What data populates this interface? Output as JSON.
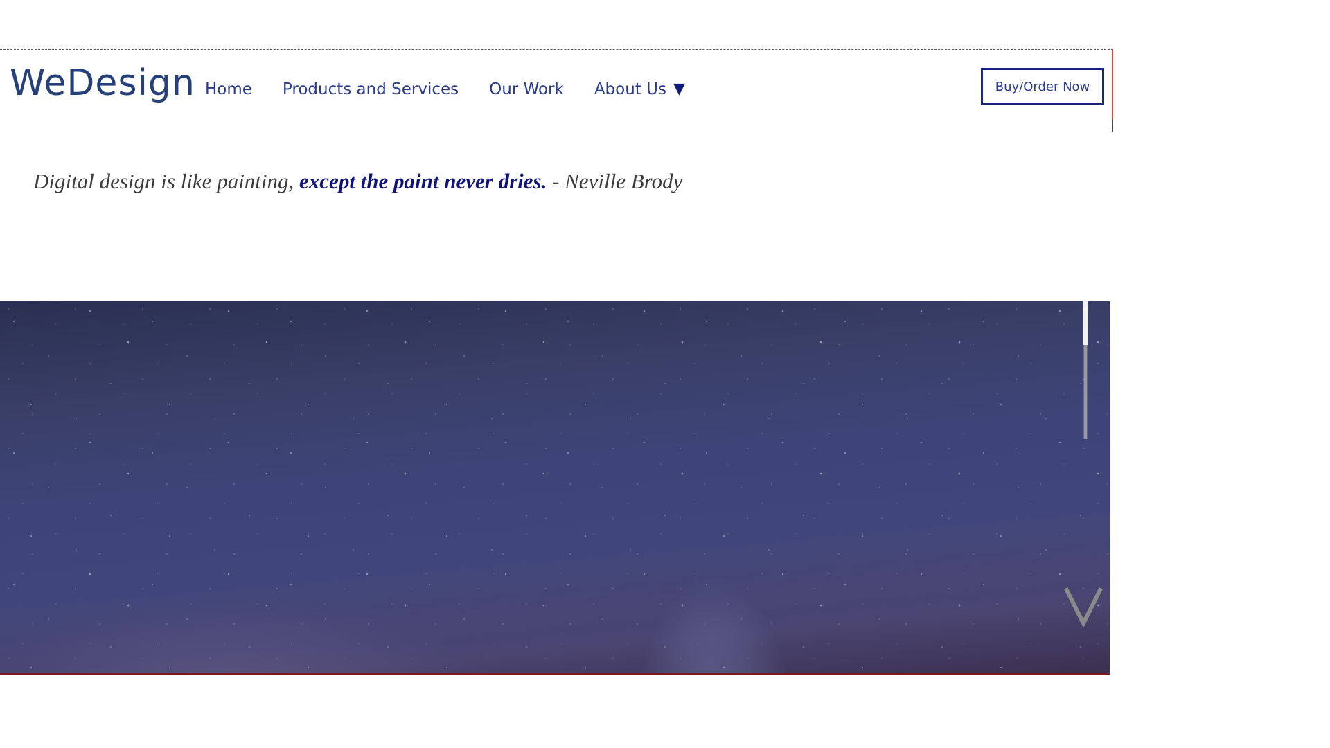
{
  "header": {
    "logo_text": "WeDesign",
    "nav": {
      "home": "Home",
      "products": "Products and Services",
      "work": "Our Work",
      "about": "About Us",
      "about_caret": "▼"
    },
    "cta_label": "Buy/Order Now"
  },
  "quote": {
    "part1": "Digital design is like painting, ",
    "part2": "except the paint never dries.",
    "part3": " - Neville Brody"
  },
  "hero": {
    "image": "milky-way-night-sky",
    "scroll_position": 0.32,
    "scroll_down_icon": "chevron-down-icon"
  },
  "colors": {
    "brand": "#243f7a",
    "nav_text": "#2a3a8c",
    "quote_emphasis": "#10147a",
    "quote_text": "#3c3c3c",
    "button_border": "#1a237e"
  }
}
